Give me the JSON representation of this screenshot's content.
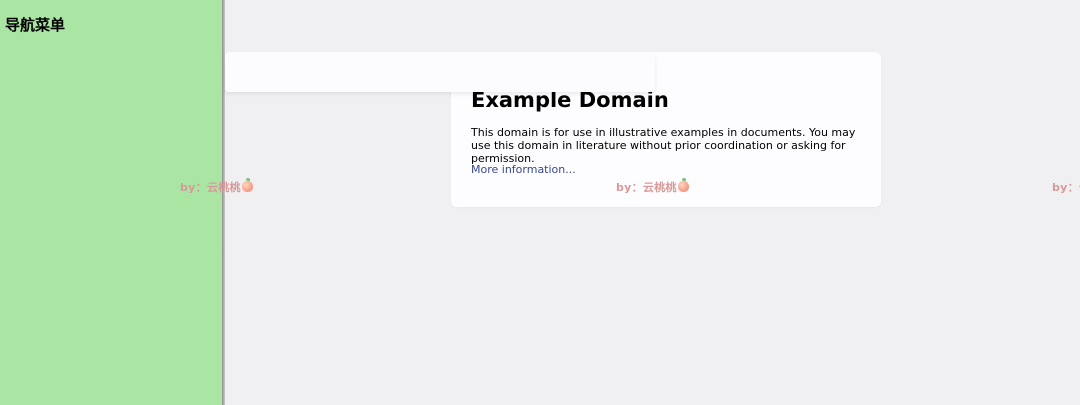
{
  "sidebar": {
    "title": "导航菜单"
  },
  "content": {
    "heading": "Example Domain",
    "body": "This domain is for use in illustrative examples in documents. You may use this domain in literature without prior coordination or asking for permission.",
    "link_text": "More information..."
  },
  "watermark": {
    "text": "by：云桃桃",
    "icon": "peach-icon"
  },
  "colors": {
    "sidebar_bg": "#abe5a4",
    "page_bg": "#f0f0f2",
    "link": "#38488f",
    "watermark": "#d79a9a"
  }
}
